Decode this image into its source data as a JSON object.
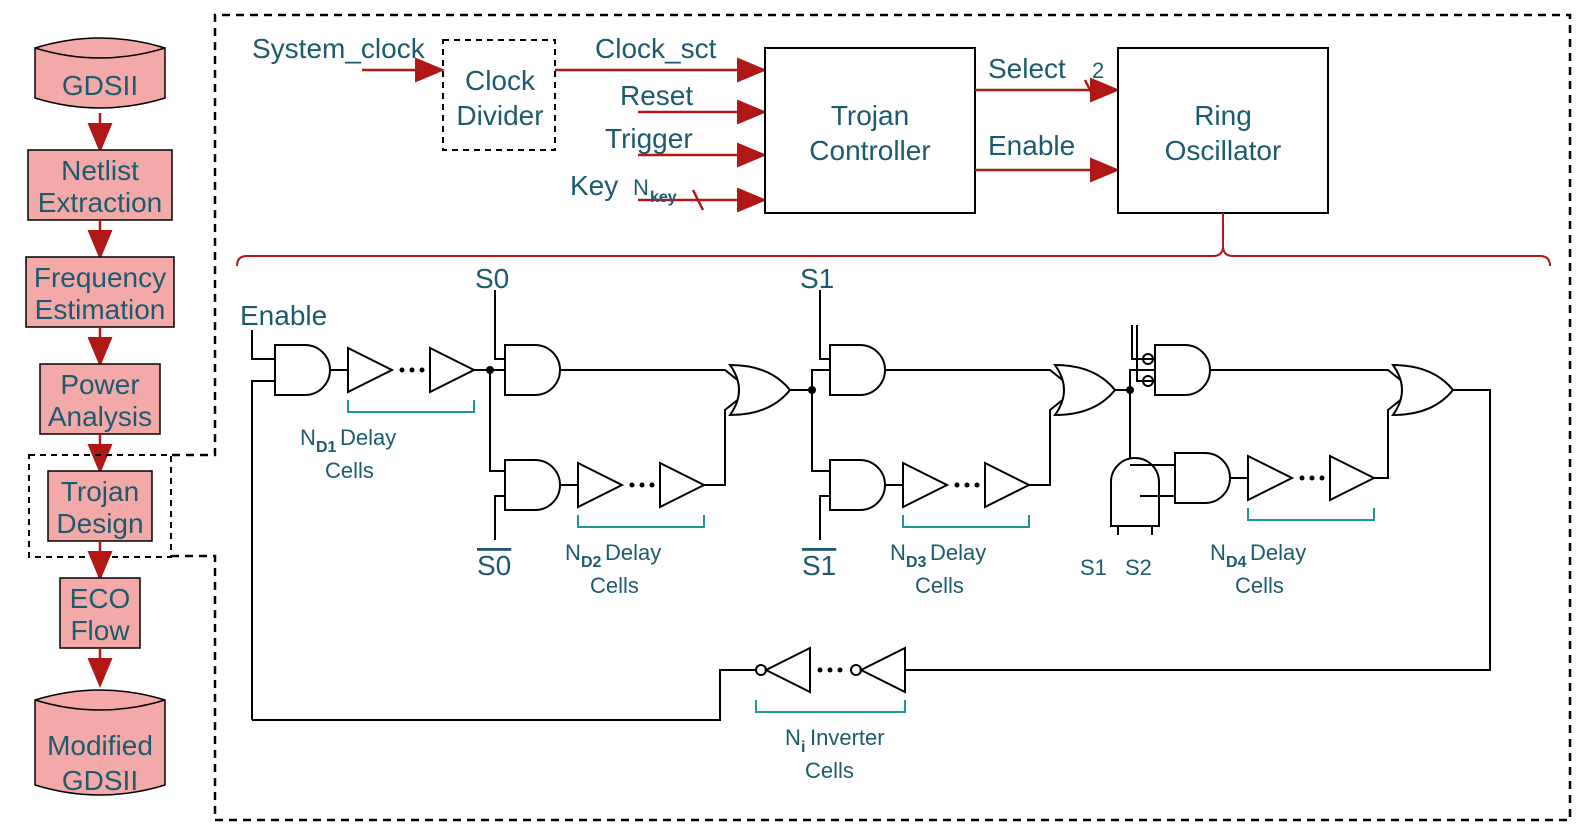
{
  "flow": {
    "step1": "GDSII",
    "step2a": "Netlist",
    "step2b": "Extraction",
    "step3a": "Frequency",
    "step3b": "Estimation",
    "step4a": "Power",
    "step4b": "Analysis",
    "step5a": "Trojan",
    "step5b": "Design",
    "step6a": "ECO",
    "step6b": "Flow",
    "step7a": "Modified",
    "step7b": "GDSII"
  },
  "top": {
    "system_clock": "System_clock",
    "clock_divider_a": "Clock",
    "clock_divider_b": "Divider",
    "clock_sct": "Clock_sct",
    "reset": "Reset",
    "trigger": "Trigger",
    "key": "Key",
    "nkey_n": "N",
    "nkey_sub": "key",
    "trojan_a": "Trojan",
    "trojan_b": "Controller",
    "select": "Select",
    "select_bits": "2",
    "enable": "Enable",
    "ring_a": "Ring",
    "ring_b": "Oscillator"
  },
  "circuit": {
    "enable": "Enable",
    "s0": "S0",
    "s0_bar": "S0",
    "s1": "S1",
    "s1_bar": "S1",
    "s2": "S2",
    "nd1_n": "N",
    "nd1_sub": "D1",
    "nd2_n": "N",
    "nd2_sub": "D2",
    "nd3_n": "N",
    "nd3_sub": "D3",
    "nd4_n": "N",
    "nd4_sub": "D4",
    "ni_n": "N",
    "ni_sub": "i",
    "delay": "Delay",
    "cells": "Cells",
    "inverter": "Inverter"
  }
}
